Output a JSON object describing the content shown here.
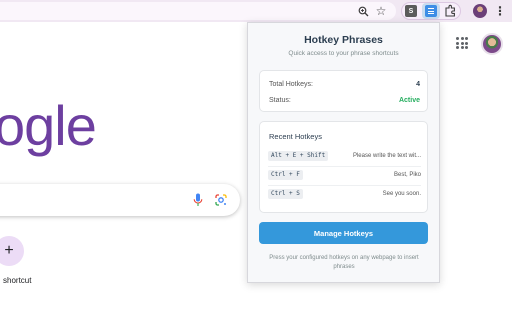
{
  "browser": {
    "toolbar_icons": [
      "zoom-icon",
      "star-icon",
      "extension-s-icon",
      "hotkey-extension-icon",
      "puzzle-icon",
      "profile-avatar",
      "more-menu-icon"
    ],
    "extension_s_label": "S"
  },
  "google": {
    "logo_text": "ogle",
    "logo_color": "#6d3fa0",
    "shortcut_label": "shortcut",
    "add_shortcut_symbol": "+"
  },
  "popup": {
    "title": "Hotkey Phrases",
    "subtitle": "Quick access to your phrase shortcuts",
    "stats": {
      "total_label": "Total Hotkeys:",
      "total_value": "4",
      "status_label": "Status:",
      "status_value": "Active",
      "status_color": "#27ae60"
    },
    "recent": {
      "title": "Recent Hotkeys",
      "items": [
        {
          "key": "Alt + E + Shift",
          "phrase": "Please write the text wit..."
        },
        {
          "key": "Ctrl + F",
          "phrase": "Best, Piko"
        },
        {
          "key": "Ctrl + S",
          "phrase": "See you soon."
        }
      ]
    },
    "manage_button": "Manage Hotkeys",
    "button_color": "#3498db",
    "footer": "Press your configured hotkeys on any webpage to insert phrases"
  }
}
